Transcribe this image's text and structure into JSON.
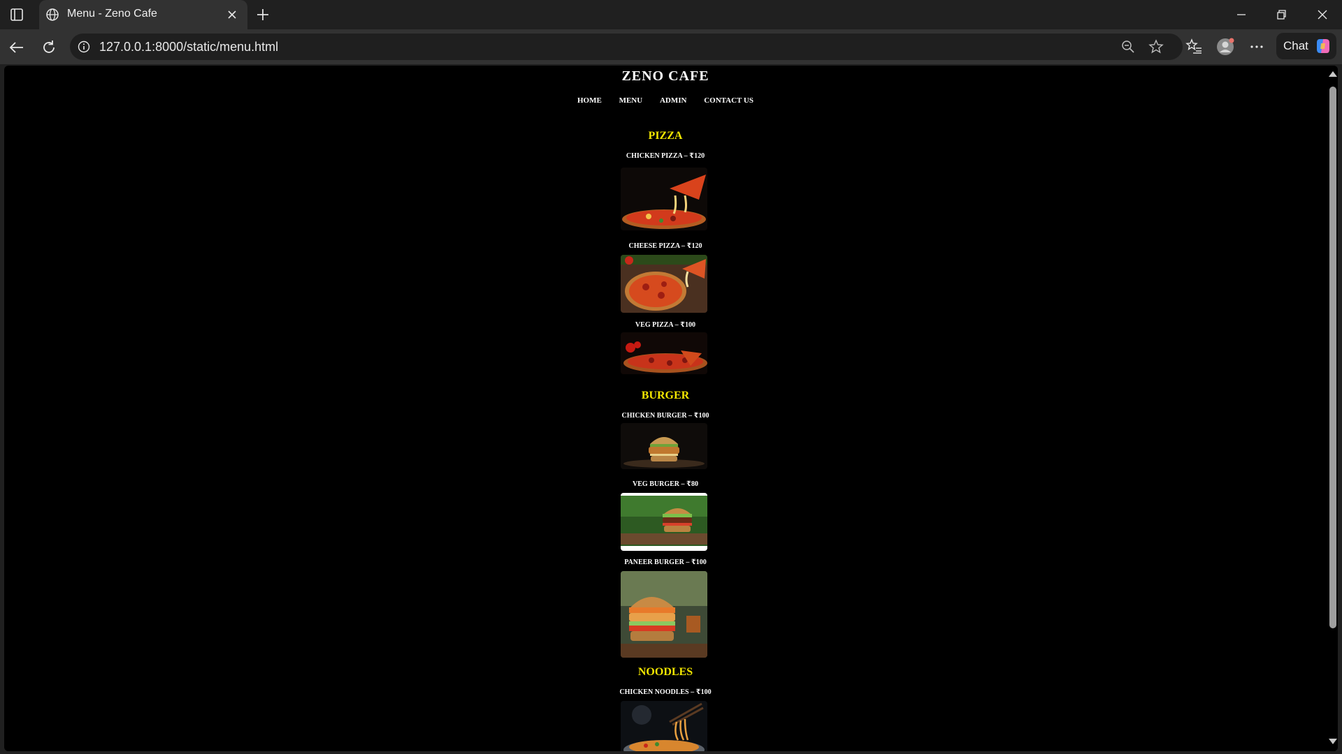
{
  "browser": {
    "tab_title": "Menu - Zeno Cafe",
    "url": "127.0.0.1:8000/static/menu.html",
    "chat_label": "Chat"
  },
  "site": {
    "title": "ZENO CAFE",
    "nav": [
      "HOME",
      "MENU",
      "ADMIN",
      "CONTACT US"
    ]
  },
  "menu": {
    "pizza": {
      "title": "PIZZA",
      "items": [
        "CHICKEN PIZZA – ₹120",
        "CHEESE PIZZA – ₹120",
        "VEG PIZZA – ₹100"
      ]
    },
    "burger": {
      "title": "BURGER",
      "items": [
        "CHICKEN BURGER – ₹100",
        "VEG BURGER – ₹80",
        "PANEER BURGER – ₹100"
      ]
    },
    "noodles": {
      "title": "NOODLES",
      "items": [
        "CHICKEN NOODLES – ₹100"
      ]
    }
  },
  "colors": {
    "section_title": "#f2e600",
    "page_background": "#000000",
    "chrome_background": "#202020"
  }
}
